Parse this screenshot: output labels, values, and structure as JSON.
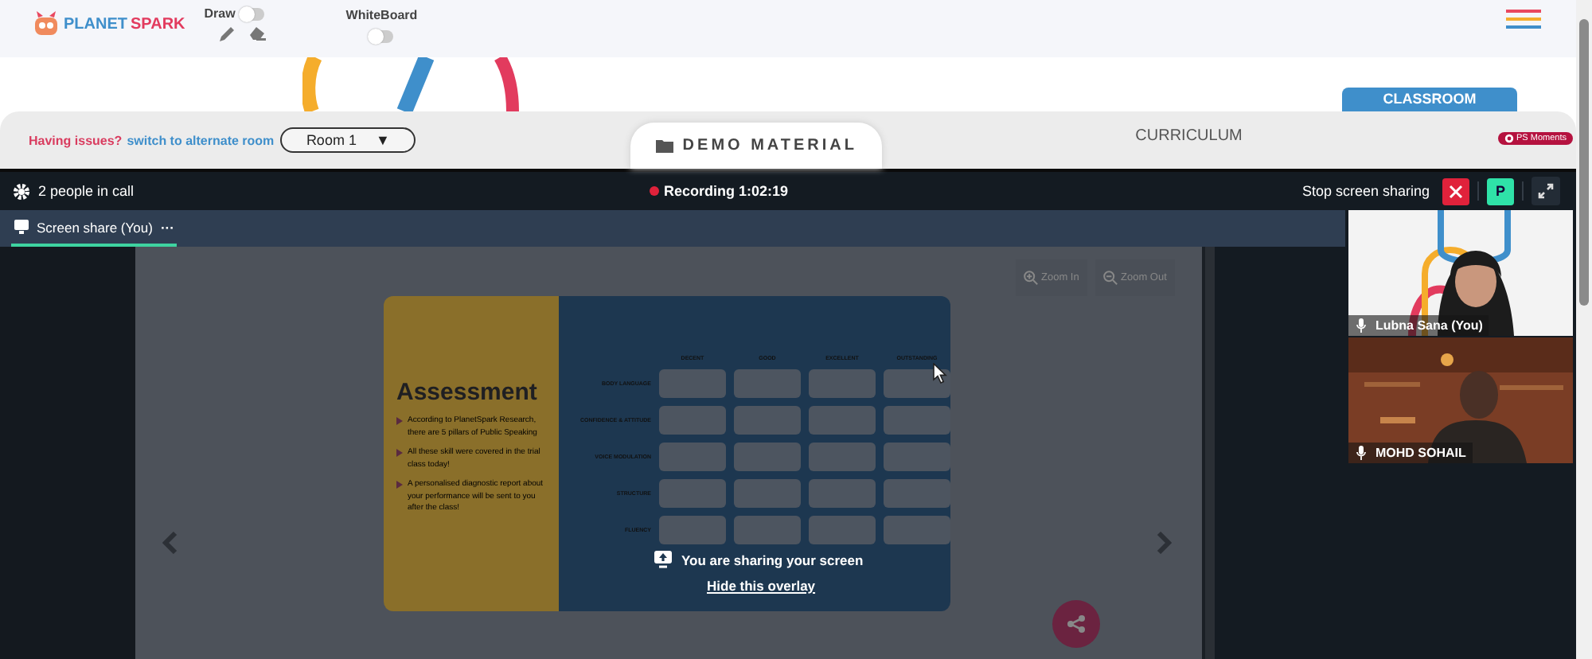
{
  "header": {
    "logo": {
      "first": "PLANET",
      "second": "SPARK"
    },
    "draw": {
      "label": "Draw",
      "on": false
    },
    "whiteboard": {
      "label": "WhiteBoard",
      "on": false
    }
  },
  "classroom_tab": {
    "label": "CLASSROOM",
    "selected": true
  },
  "room_bar": {
    "issue_text": "Having issues?",
    "switch_link": "switch to alternate room",
    "room_select": {
      "value": "Room 1",
      "caret": "▼"
    },
    "demo_button": "DEMO MATERIAL",
    "curriculum": "CURRICULUM",
    "ps_moments": "PS Moments"
  },
  "call": {
    "people": "2 people in call",
    "recording": "Recording 1:02:19",
    "stop_sharing": "Stop screen sharing",
    "participant_badge": "P"
  },
  "tabs": [
    {
      "label": "Screen share (You)",
      "selected": true,
      "more": "···"
    }
  ],
  "viewer": {
    "zoom_in": "Zoom In",
    "zoom_out": "Zoom Out"
  },
  "slide": {
    "title": "Assessment",
    "bullets": [
      "According to PlanetSpark Research, there are 5 pillars of Public Speaking",
      "All these skill were covered in the trial class today!",
      "A personalised diagnostic report about your performance will be sent to you after the class!"
    ],
    "columns": [
      "DECENT",
      "GOOD",
      "EXCELLENT",
      "OUTSTANDING"
    ],
    "rows": [
      "BODY LANGUAGE",
      "CONFIDENCE & ATTITUDE",
      "VOICE MODULATION",
      "STRUCTURE",
      "FLUENCY"
    ]
  },
  "overlay": {
    "message": "You are sharing your screen",
    "hide_link": "Hide this overlay"
  },
  "participants": [
    {
      "name": "Lubna Sana (You)",
      "kind": "light"
    },
    {
      "name": "MOHD SOHAIL",
      "kind": "brick"
    }
  ]
}
